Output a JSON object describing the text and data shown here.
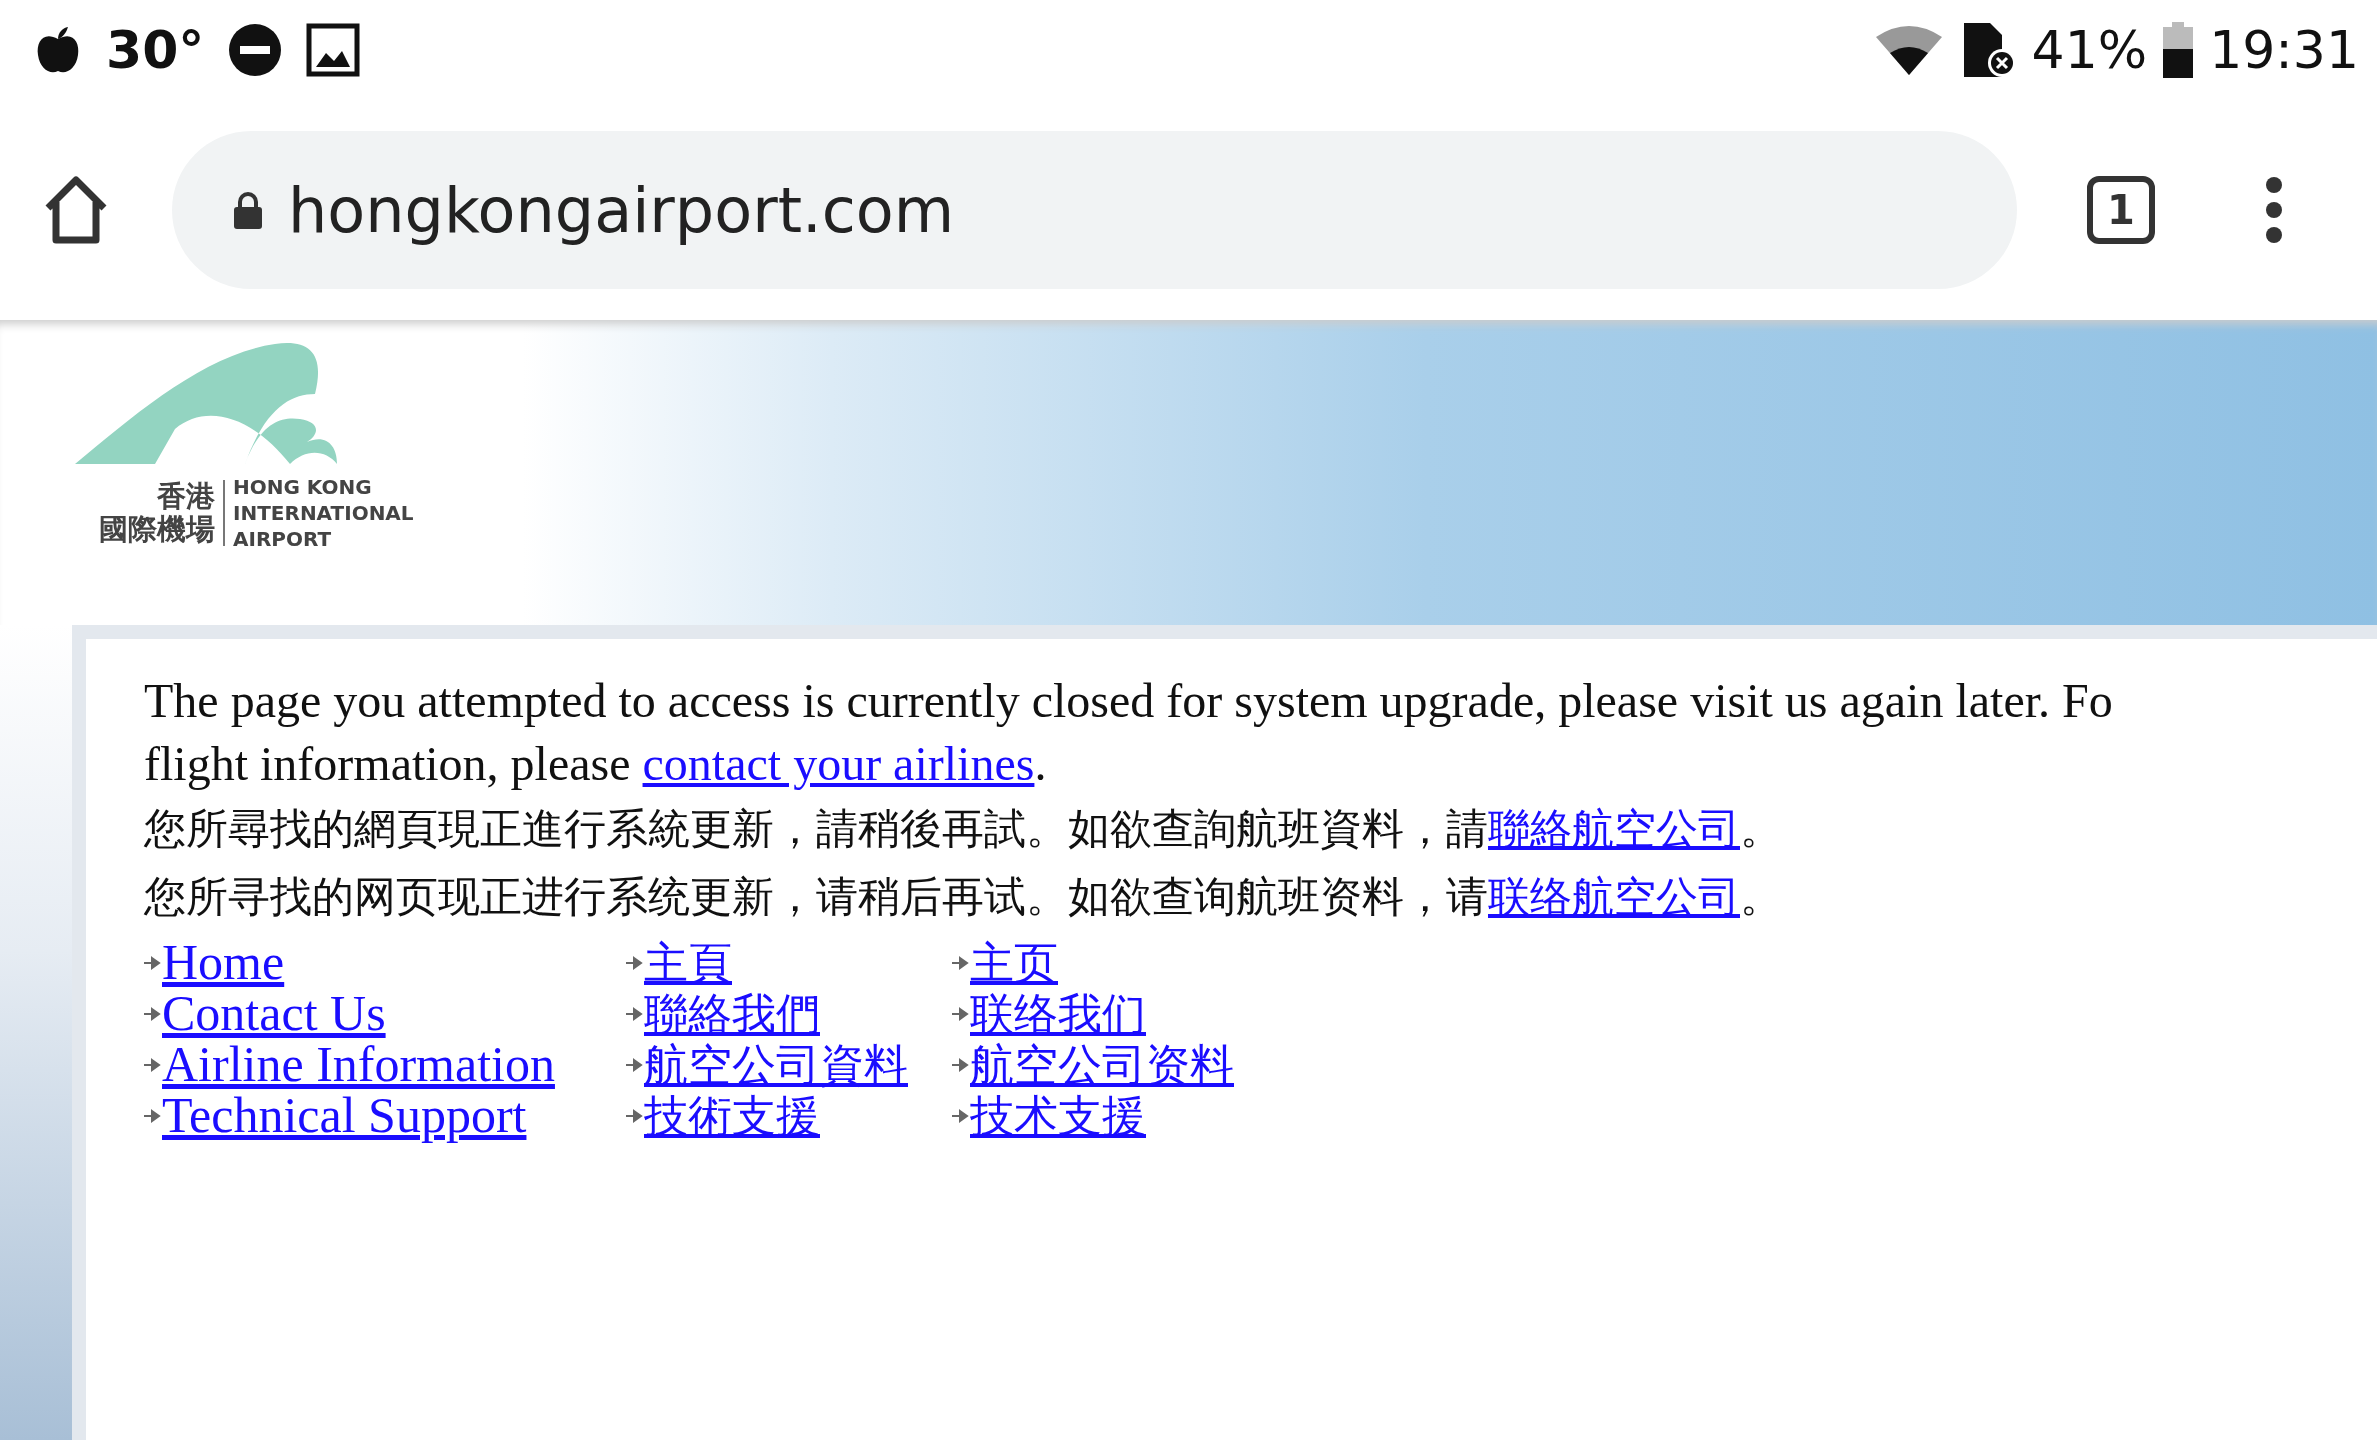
{
  "status_bar": {
    "temperature": "30°",
    "battery": "41%",
    "time": "19:31"
  },
  "browser_toolbar": {
    "url": "hongkongairport.com",
    "tab_count": "1"
  },
  "logo": {
    "chinese_lines": [
      "香港",
      "國際機場"
    ],
    "english_lines": [
      "HONG KONG",
      "INTERNATIONAL",
      "AIRPORT"
    ]
  },
  "message_lines": [
    {
      "text": "The page you attempted to access is currently closed for system upgrade, please visit us again later. Fo"
    },
    {
      "text": "flight information, please ",
      "link": "contact your airlines",
      "after": "."
    },
    {
      "text": "您所尋找的網頁現正進行系統更新，請稍後再試。如欲查詢航班資料，請",
      "link": "聯絡航空公司",
      "after": "。"
    },
    {
      "text": "您所寻找的网页现正进行系统更新，请稍后再试。如欲查询航班资料，请",
      "link": "联络航空公司",
      "after": "。"
    }
  ],
  "link_columns": [
    [
      "Home",
      "Contact Us",
      "Airline Information",
      "Technical Support"
    ],
    [
      "主頁",
      "聯絡我們",
      "航空公司資料",
      "技術支援"
    ],
    [
      "主页",
      "联络我们",
      "航空公司资料",
      "技术支援"
    ]
  ]
}
